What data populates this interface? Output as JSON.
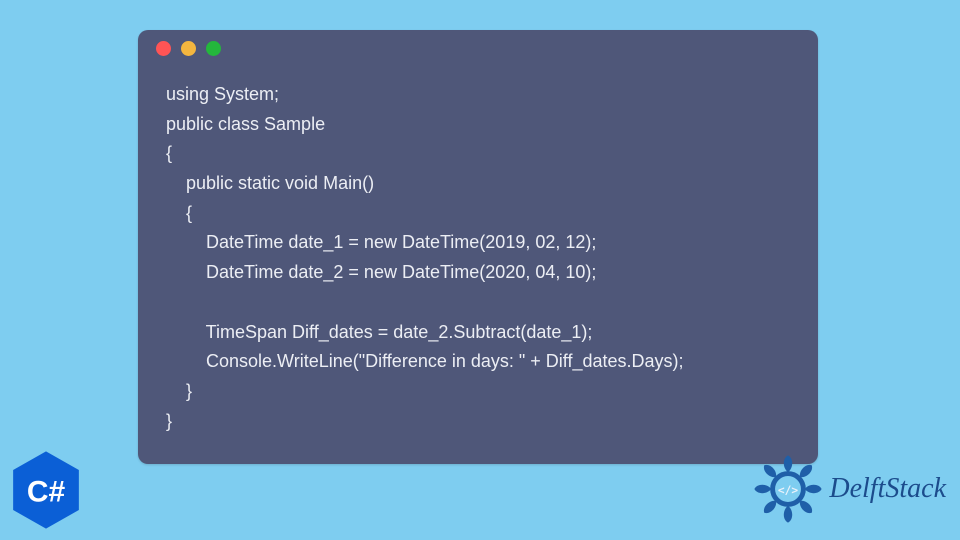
{
  "code": {
    "lines": [
      "using System;",
      "public class Sample",
      "{",
      "    public static void Main()",
      "    {",
      "        DateTime date_1 = new DateTime(2019, 02, 12);",
      "        DateTime date_2 = new DateTime(2020, 04, 10);",
      "",
      "        TimeSpan Diff_dates = date_2.Subtract(date_1);",
      "        Console.WriteLine(\"Difference in days: \" + Diff_dates.Days);",
      "    }",
      "}"
    ]
  },
  "badge": {
    "language": "C#"
  },
  "brand": {
    "name": "DelftStack"
  },
  "colors": {
    "bg": "#7ecdf0",
    "window": "#4f5779",
    "red": "#ff5455",
    "yellow": "#f4b63f",
    "green": "#24b73c",
    "badge": "#0b5fd6",
    "brand_text": "#1c4c8c",
    "brand_logo": "#1f5fa8"
  }
}
